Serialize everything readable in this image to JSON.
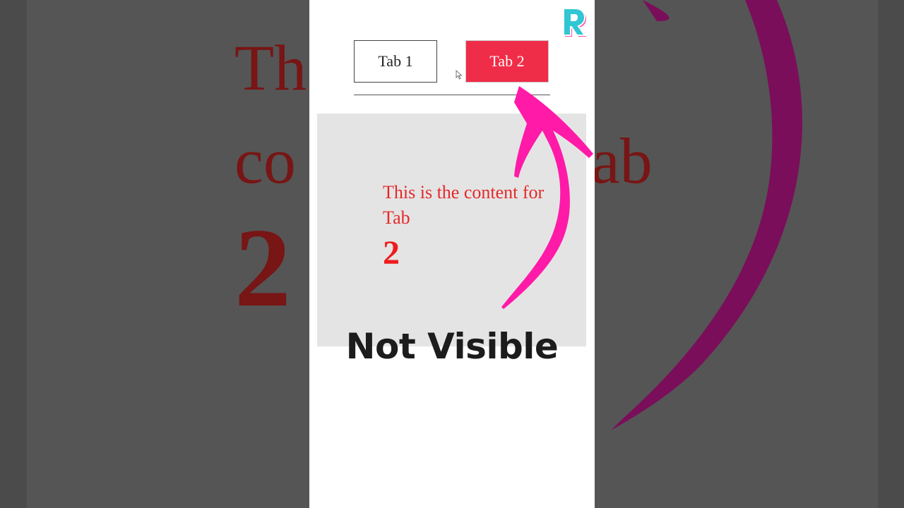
{
  "tabs": [
    {
      "label": "Tab 1",
      "active": false
    },
    {
      "label": "Tab 2",
      "active": true
    }
  ],
  "content": {
    "text": "This is the content for Tab",
    "number": "2"
  },
  "caption": "Not Visible",
  "background": {
    "text_line1": "Th",
    "text_line2": "co",
    "text_line2_right": "ab",
    "text_number": "2"
  },
  "logo": {
    "letter": "R",
    "icon": "r-logo-icon"
  },
  "colors": {
    "active_tab": "#f02d48",
    "content_text": "#e42a2a",
    "arrow": "#ff1aa8",
    "panel": "#e4e4e4"
  }
}
